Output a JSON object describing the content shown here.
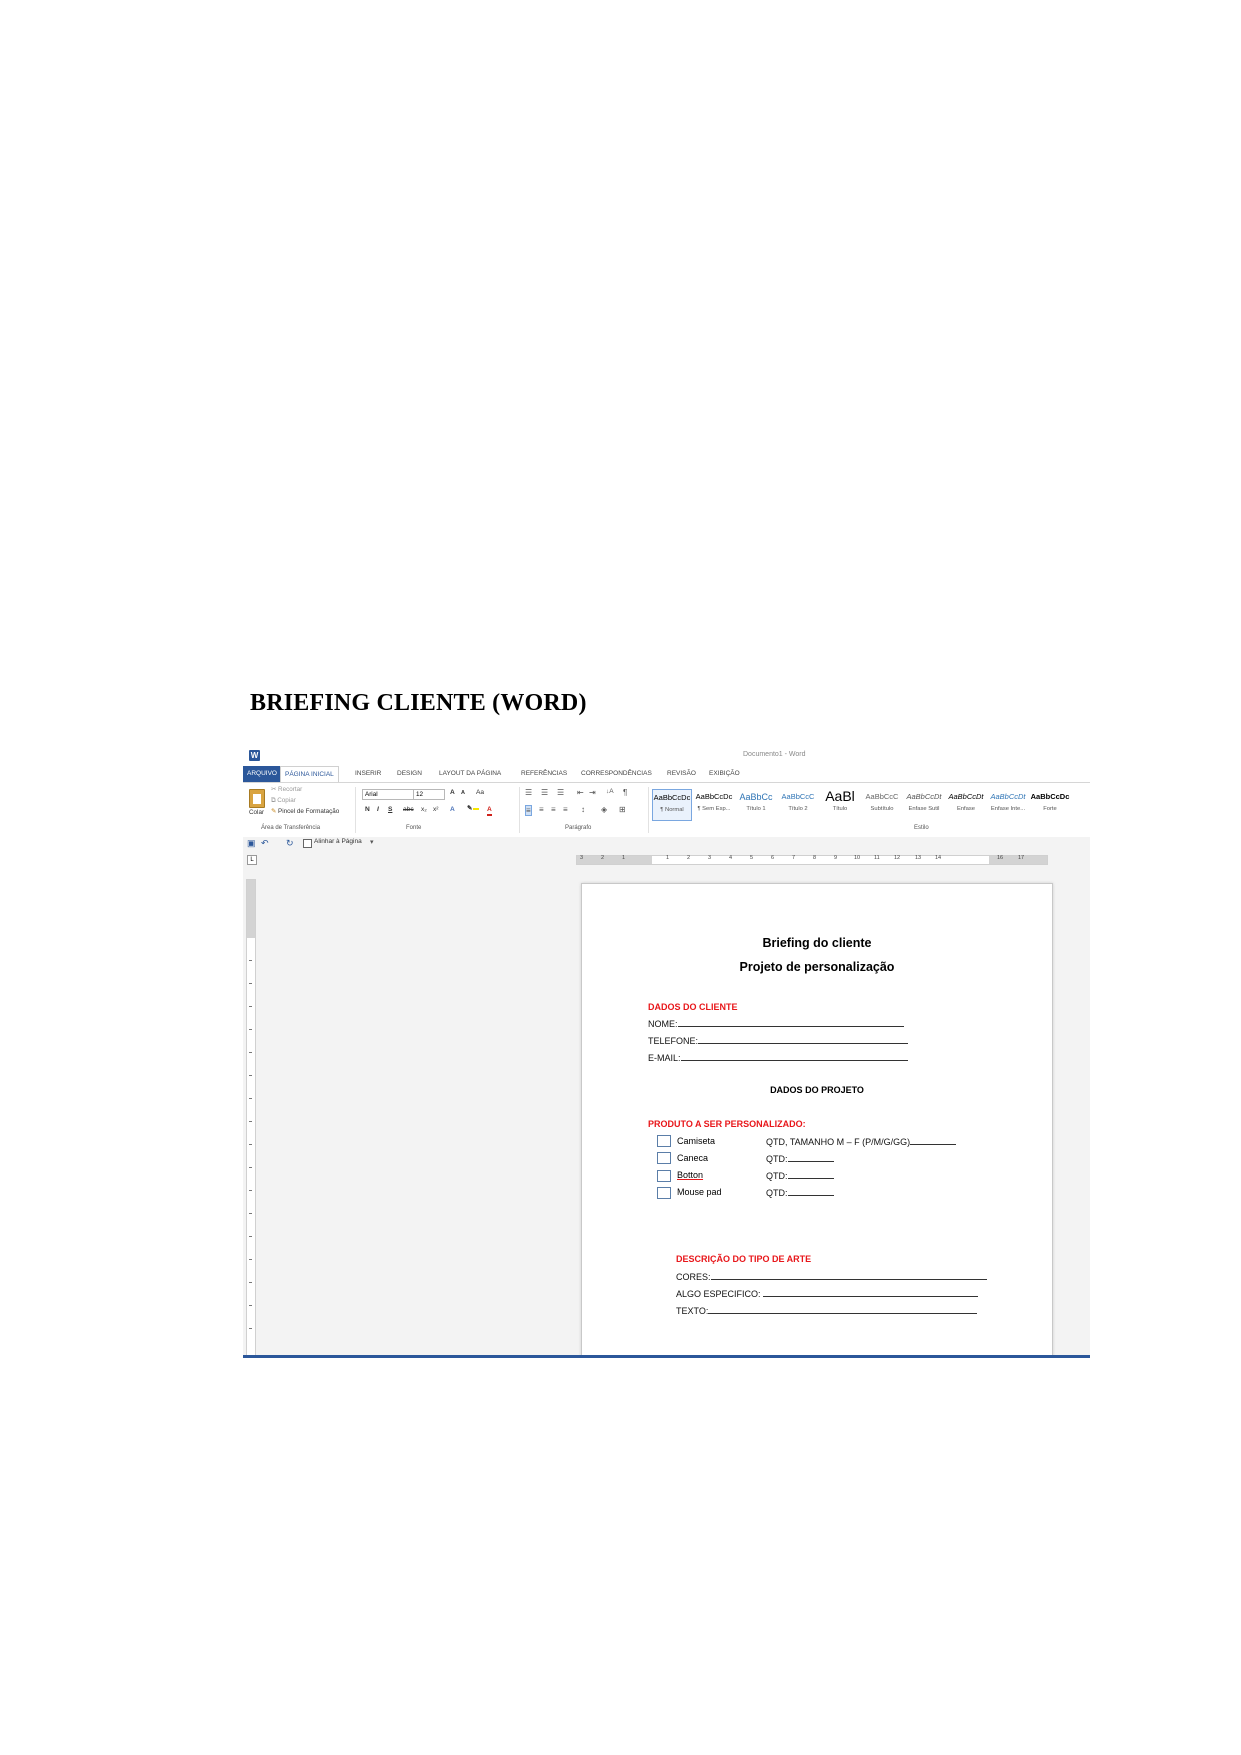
{
  "heading": "BRIEFING CLIENTE (WORD)",
  "window": {
    "title": "Documento1 - Word",
    "app_icon": "word-icon"
  },
  "tabs": [
    {
      "label": "ARQUIVO"
    },
    {
      "label": "PÁGINA INICIAL"
    },
    {
      "label": "INSERIR"
    },
    {
      "label": "DESIGN"
    },
    {
      "label": "LAYOUT DA PÁGINA"
    },
    {
      "label": "REFERÊNCIAS"
    },
    {
      "label": "CORRESPONDÊNCIAS"
    },
    {
      "label": "REVISÃO"
    },
    {
      "label": "EXIBIÇÃO"
    }
  ],
  "ribbon": {
    "clipboard": {
      "paste": "Colar",
      "cut": "Recortar",
      "copy": "Copiar",
      "format_painter": "Pincel de Formatação",
      "group": "Área de Transferência"
    },
    "font": {
      "name": "Arial",
      "size": "12",
      "group": "Fonte",
      "bold": "N",
      "italic": "I",
      "underline": "S",
      "strike": "abc",
      "sub": "x₂",
      "sup": "x²",
      "case": "Aa",
      "grow": "A",
      "shrink": "A"
    },
    "paragraph": {
      "group": "Parágrafo",
      "pilcrow": "¶",
      "sort": "↓A"
    },
    "styles": {
      "group": "Estilo",
      "items": [
        {
          "preview": "AaBbCcDc",
          "name": "¶ Normal"
        },
        {
          "preview": "AaBbCcDc",
          "name": "¶ Sem Esp..."
        },
        {
          "preview": "AaBbCc",
          "name": "Título 1"
        },
        {
          "preview": "AaBbCcC",
          "name": "Título 2"
        },
        {
          "preview": "AaBl",
          "name": "Título"
        },
        {
          "preview": "AaBbCcC",
          "name": "Subtítulo"
        },
        {
          "preview": "AaBbCcDt",
          "name": "Ênfase Sutil"
        },
        {
          "preview": "AaBbCcDt",
          "name": "Ênfase"
        },
        {
          "preview": "AaBbCcDt",
          "name": "Ênfase Inte..."
        },
        {
          "preview": "AaBbCcDc",
          "name": "Forte"
        }
      ]
    }
  },
  "qat": {
    "align_label": "Alinhar à Página"
  },
  "ruler_numbers": [
    "3",
    "2",
    "1",
    "1",
    "2",
    "3",
    "4",
    "5",
    "6",
    "7",
    "8",
    "9",
    "10",
    "11",
    "12",
    "13",
    "14",
    "16",
    "17"
  ],
  "document": {
    "title": "Briefing do cliente",
    "subtitle": "Projeto de personalização",
    "client_section": "DADOS DO CLIENTE",
    "client_fields": [
      "NOME:",
      "TELEFONE:",
      "E-MAIL:"
    ],
    "project_section": "DADOS DO PROJETO",
    "product_section": "PRODUTO A SER PERSONALIZADO:",
    "products": [
      {
        "label": "Camiseta",
        "qty": "QTD, TAMANHO M – F (P/M/G/GG)"
      },
      {
        "label": "Caneca",
        "qty": "QTD:"
      },
      {
        "label": "Botton",
        "qty": "QTD:"
      },
      {
        "label": "Mouse pad",
        "qty": "QTD:"
      }
    ],
    "art_section": "DESCRIÇÃO DO TIPO DE ARTE",
    "art_fields": [
      "CORES:",
      "ALGO ESPECIFICO:",
      "TEXTO:"
    ]
  }
}
